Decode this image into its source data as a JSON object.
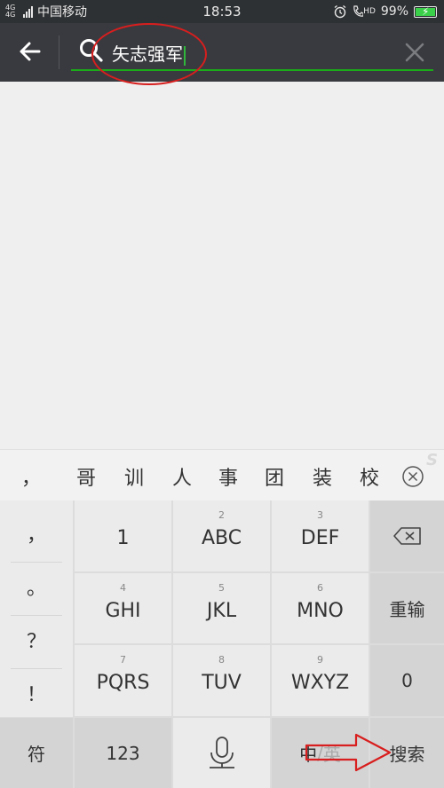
{
  "status_bar": {
    "network_type": "4G 4G",
    "carrier": "中国移动",
    "time": "18:53",
    "hd_label": "HD",
    "battery_percent": "99%",
    "battery_level": 0.99,
    "icons": [
      "signal-icon",
      "alarm-icon",
      "hd-call-icon",
      "battery-charging-icon"
    ]
  },
  "header": {
    "search_query": "矢志强军",
    "accent_color": "#1aad19",
    "annotation_color": "#d81e1e"
  },
  "candidates": {
    "items": [
      "，",
      "哥",
      "训",
      "人",
      "事",
      "团",
      "装",
      "校"
    ]
  },
  "keyboard": {
    "punctuation": [
      "，",
      "。",
      "？",
      "！"
    ],
    "keys": [
      {
        "num": "",
        "label": "1"
      },
      {
        "num": "2",
        "label": "ABC"
      },
      {
        "num": "3",
        "label": "DEF"
      },
      {
        "num": "4",
        "label": "GHI"
      },
      {
        "num": "5",
        "label": "JKL"
      },
      {
        "num": "6",
        "label": "MNO"
      },
      {
        "num": "7",
        "label": "PQRS"
      },
      {
        "num": "8",
        "label": "TUV"
      },
      {
        "num": "9",
        "label": "WXYZ"
      }
    ],
    "reenter": "重输",
    "zero": "0",
    "symbols": "符",
    "numbers": "123",
    "lang_cn": "中",
    "lang_sep": "/",
    "lang_en": "英",
    "search": "搜索"
  }
}
